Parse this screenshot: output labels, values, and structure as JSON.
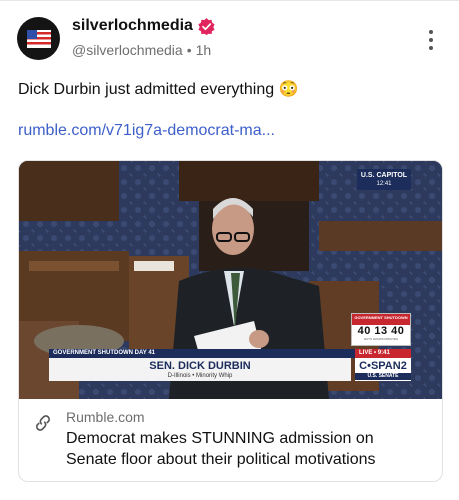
{
  "post": {
    "username": "silverlochmedia",
    "handle": "@silverlochmedia",
    "separator": "•",
    "time": "1h",
    "text": "Dick Durbin just admitted everything 😳",
    "link": "rumble.com/v71ig7a-democrat-ma..."
  },
  "card": {
    "domain": "Rumble.com",
    "title": "Democrat makes STUNNING admission on Senate floor about their political motivations",
    "video": {
      "capitol_tag": "U.S. CAPITOL",
      "capitol_time": "12:41",
      "shutdown_header": "GOVERNMENT SHUTDOWN",
      "countdown": "40 13 40",
      "countdown_labels": "DAYS  HOURS  MINUTES",
      "live_label": "LIVE • 9:41",
      "shutdown_day": "GOVERNMENT SHUTDOWN DAY 41",
      "speaker_name": "SEN. DICK DURBIN",
      "speaker_sub": "D-Illinois • Minority Whip",
      "network": "C•SPAN2",
      "network_sub": "U.S. SENATE"
    }
  },
  "colors": {
    "link": "#3d5fc9",
    "verified": "#e0245e",
    "cspan_navy": "#1c2d5c",
    "cspan_red": "#c8272f"
  },
  "icons": {
    "avatar": "us-flag-icon",
    "verified": "verified-badge-icon",
    "menu": "kebab-menu-icon",
    "link": "link-icon"
  }
}
